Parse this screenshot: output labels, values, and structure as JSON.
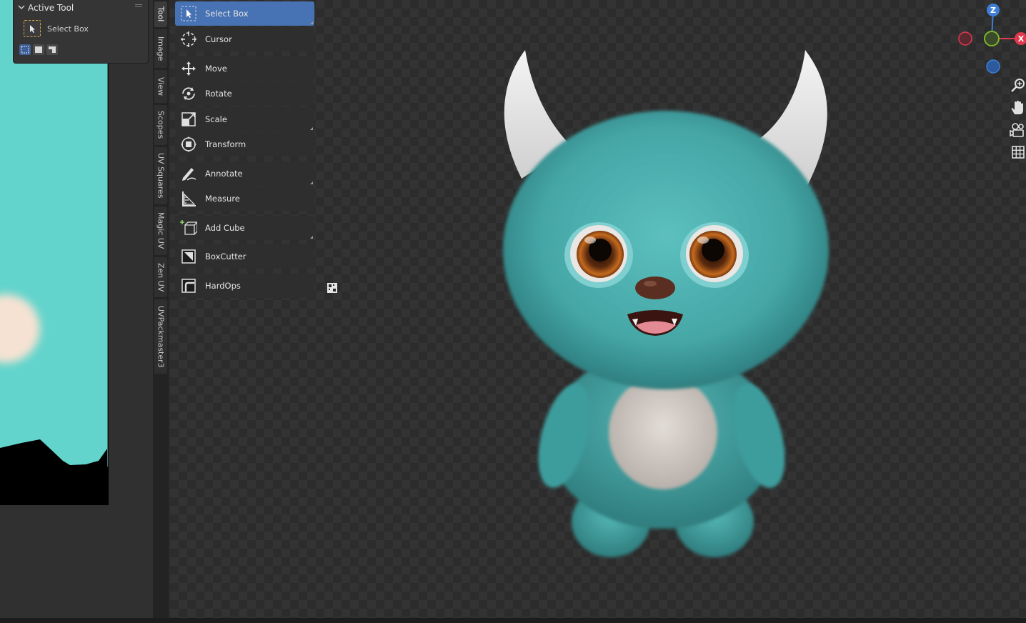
{
  "active_tool_panel": {
    "title": "Active Tool",
    "tool_name": "Select Box"
  },
  "sidebar_tabs": [
    "Tool",
    "Image",
    "View",
    "Scopes",
    "UV Squares",
    "Magic UV",
    "Zen UV",
    "UVPackmaster3"
  ],
  "toolbar": {
    "tools": [
      {
        "label": "Select Box",
        "icon": "select-box-icon"
      },
      {
        "label": "Cursor",
        "icon": "cursor-icon"
      },
      {
        "label": "Move",
        "icon": "move-icon"
      },
      {
        "label": "Rotate",
        "icon": "rotate-icon"
      },
      {
        "label": "Scale",
        "icon": "scale-icon"
      },
      {
        "label": "Transform",
        "icon": "transform-icon"
      },
      {
        "label": "Annotate",
        "icon": "annotate-icon"
      },
      {
        "label": "Measure",
        "icon": "measure-icon"
      },
      {
        "label": "Add Cube",
        "icon": "add-cube-icon"
      },
      {
        "label": "BoxCutter",
        "icon": "boxcutter-icon"
      },
      {
        "label": "HardOps",
        "icon": "hardops-icon"
      }
    ]
  },
  "gizmo": {
    "z_label": "Z",
    "x_label": "X",
    "colors": {
      "x": "#e0394d",
      "y": "#7db52b",
      "z": "#3d7ed6"
    }
  },
  "colors": {
    "accent": "#4772b3",
    "uv_background": "#62d4cc",
    "character_fur": "#4fb3b2"
  }
}
